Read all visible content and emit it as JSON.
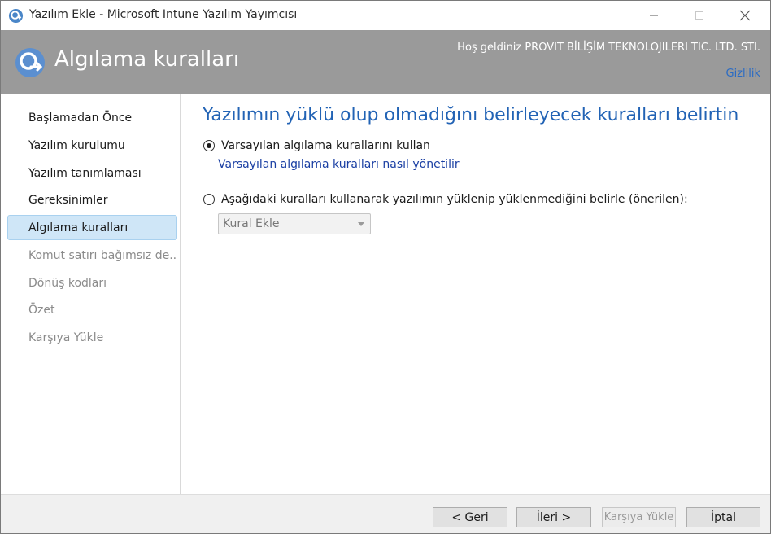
{
  "window": {
    "title": "Yazılım Ekle - Microsoft Intune Yazılım Yayımcısı"
  },
  "header": {
    "title": "Algılama kuralları",
    "welcome": "Hoş geldiniz PROVIT BİLİŞİM TEKNOLOJILERI TIC. LTD. STI.",
    "privacy_link": "Gizlilik"
  },
  "sidebar": {
    "items": [
      {
        "label": "Başlamadan Önce",
        "state": "done"
      },
      {
        "label": "Yazılım kurulumu",
        "state": "done"
      },
      {
        "label": "Yazılım tanımlaması",
        "state": "done"
      },
      {
        "label": "Gereksinimler",
        "state": "done"
      },
      {
        "label": "Algılama kuralları",
        "state": "active"
      },
      {
        "label": "Komut satırı bağımsız de...",
        "state": "pending"
      },
      {
        "label": "Dönüş kodları",
        "state": "pending"
      },
      {
        "label": "Özet",
        "state": "pending"
      },
      {
        "label": "Karşıya Yükle",
        "state": "pending"
      }
    ]
  },
  "main": {
    "heading": "Yazılımın yüklü olup olmadığını belirleyecek kuralları belirtin",
    "option_default": {
      "label": "Varsayılan algılama kurallarını kullan",
      "selected": true
    },
    "help_link": "Varsayılan algılama kuralları nasıl yönetilir",
    "option_custom": {
      "label": "Aşağıdaki kuralları kullanarak yazılımın yüklenip yüklenmediğini belirle (önerilen):",
      "selected": false
    },
    "rule_dropdown": {
      "value": "Kural Ekle",
      "enabled": false
    }
  },
  "footer": {
    "back_label": "< Geri",
    "next_label": "İleri >",
    "upload_label": "Karşıya Yükle",
    "cancel_label": "İptal"
  },
  "colors": {
    "header_bg": "#9a9a9a",
    "heading_blue": "#2263b5",
    "link_blue": "#1a3fa3",
    "active_nav_bg": "#cfe6f7"
  }
}
